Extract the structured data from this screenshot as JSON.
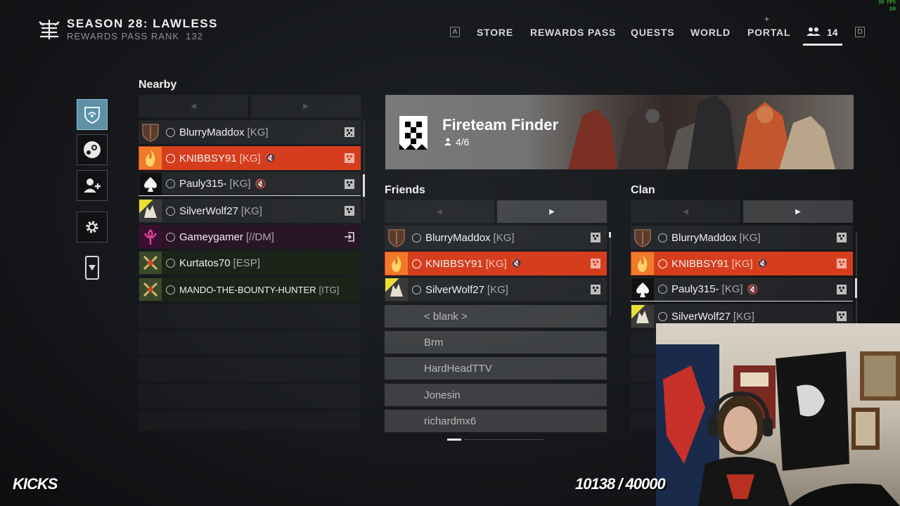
{
  "header": {
    "season_title": "SEASON 28: LAWLESS",
    "rank_label": "REWARDS PASS RANK",
    "rank_value": "132",
    "nav": [
      {
        "key": "A"
      },
      {
        "label": "STORE"
      },
      {
        "label": "REWARDS PASS"
      },
      {
        "label": "QUESTS"
      },
      {
        "label": "WORLD"
      },
      {
        "label": "PORTAL"
      }
    ],
    "friends_count": "14",
    "right_key": "D",
    "fps_label": "30 FPS",
    "fps_value": "30"
  },
  "nearby": {
    "title": "Nearby",
    "rows": [
      {
        "name": "BlurryMaddox",
        "clan": "[KG]",
        "style": "normal",
        "emblem": "shield"
      },
      {
        "name": "KNIBBSY91",
        "clan": "[KG]",
        "style": "red",
        "emblem": "flame",
        "muted": true
      },
      {
        "name": "Pauly315-",
        "clan": "[KG]",
        "style": "normal",
        "emblem": "spade",
        "muted": true
      },
      {
        "name": "SilverWolf27",
        "clan": "[KG]",
        "style": "normal",
        "emblem": "wolf"
      },
      {
        "name": "Gameygamer",
        "clan": "[//DM]",
        "style": "purple",
        "emblem": "tendrils"
      },
      {
        "name": "Kurtatos70",
        "clan": "[ESP]",
        "style": "green",
        "emblem": "crossed-axes"
      },
      {
        "name": "MANDO-THE-BOUNTY-HUNTER",
        "clan": "[ITG]",
        "style": "green",
        "emblem": "crossed-axes"
      }
    ],
    "mute_glyph": "🔇"
  },
  "fireteam": {
    "title": "Fireteam Finder",
    "count": "4/6"
  },
  "friends": {
    "title": "Friends",
    "rows": [
      {
        "name": "BlurryMaddox",
        "clan": "[KG]",
        "style": "normal"
      },
      {
        "name": "KNIBBSY91",
        "clan": "[KG]",
        "style": "red",
        "muted": true
      },
      {
        "name": "SilverWolf27",
        "clan": "[KG]",
        "style": "normal"
      }
    ],
    "offline": [
      "< blank >",
      "Brm",
      "HardHeadTTV",
      "Jonesin",
      "richardmx6"
    ]
  },
  "clan": {
    "title": "Clan",
    "rows": [
      {
        "name": "BlurryMaddox",
        "clan": "[KG]",
        "style": "normal"
      },
      {
        "name": "KNIBBSY91",
        "clan": "[KG]",
        "style": "red",
        "muted": true
      },
      {
        "name": "Pauly315-",
        "clan": "[KG]",
        "style": "normal",
        "muted": true
      },
      {
        "name": "SilverWolf27",
        "clan": "[KG]",
        "style": "normal"
      }
    ]
  },
  "overlay": {
    "kicks_label": "KICKS",
    "counter": "10138 / 40000"
  },
  "colors": {
    "accent_red": "#d63d1d",
    "rail_active": "#5e90a6"
  }
}
